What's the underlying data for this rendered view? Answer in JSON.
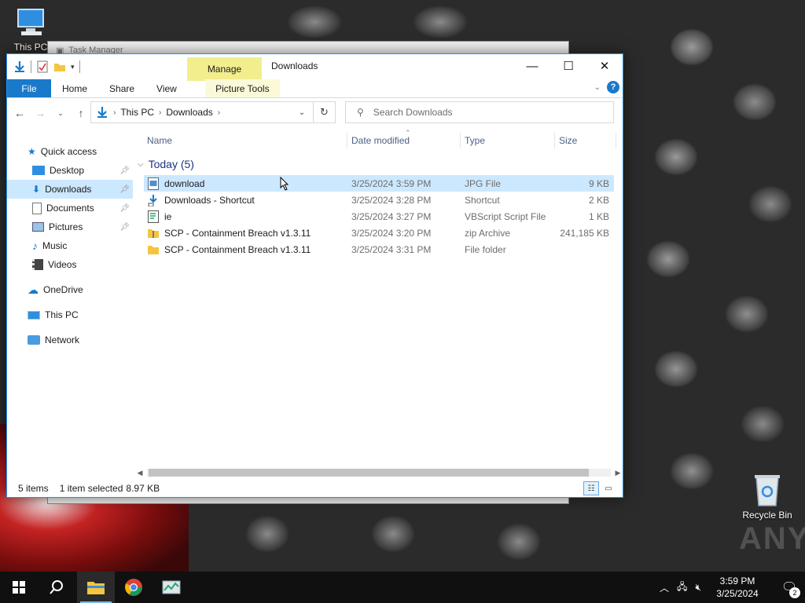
{
  "desktop": {
    "icons": [
      {
        "label": "This PC"
      },
      {
        "label": "Recycle Bin"
      }
    ],
    "watermark": "ANY"
  },
  "background_window": {
    "title": "Task Manager"
  },
  "explorer": {
    "title": "Downloads",
    "contextual_group": "Manage",
    "ribbon_tabs": [
      "File",
      "Home",
      "Share",
      "View",
      "Picture Tools"
    ],
    "address": {
      "crumbs": [
        "This PC",
        "Downloads"
      ]
    },
    "search": {
      "placeholder": "Search Downloads"
    },
    "sidebar": {
      "items": [
        {
          "label": "Quick access"
        },
        {
          "label": "Desktop"
        },
        {
          "label": "Downloads"
        },
        {
          "label": "Documents"
        },
        {
          "label": "Pictures"
        },
        {
          "label": "Music"
        },
        {
          "label": "Videos"
        },
        {
          "label": "OneDrive"
        },
        {
          "label": "This PC"
        },
        {
          "label": "Network"
        }
      ]
    },
    "columns": [
      "Name",
      "Date modified",
      "Type",
      "Size"
    ],
    "group_header": "Today (5)",
    "files": [
      {
        "name": "download",
        "date": "3/25/2024 3:59 PM",
        "type": "JPG File",
        "size": "9 KB"
      },
      {
        "name": "Downloads - Shortcut",
        "date": "3/25/2024 3:28 PM",
        "type": "Shortcut",
        "size": "2 KB"
      },
      {
        "name": "ie",
        "date": "3/25/2024 3:27 PM",
        "type": "VBScript Script File",
        "size": "1 KB"
      },
      {
        "name": "SCP - Containment Breach v1.3.11",
        "date": "3/25/2024 3:20 PM",
        "type": "zip Archive",
        "size": "241,185 KB"
      },
      {
        "name": "SCP - Containment Breach v1.3.11",
        "date": "3/25/2024 3:31 PM",
        "type": "File folder",
        "size": ""
      }
    ],
    "status": {
      "items": "5 items",
      "selected": "1 item selected",
      "selected_size": "8.97 KB"
    }
  },
  "taskbar": {
    "time": "3:59 PM",
    "date": "3/25/2024",
    "notification_count": "2"
  },
  "colors": {
    "accent": "#1979ca",
    "selection": "#cce8ff",
    "manage_tab": "#f2ee8e",
    "taskbar": "#101010"
  }
}
